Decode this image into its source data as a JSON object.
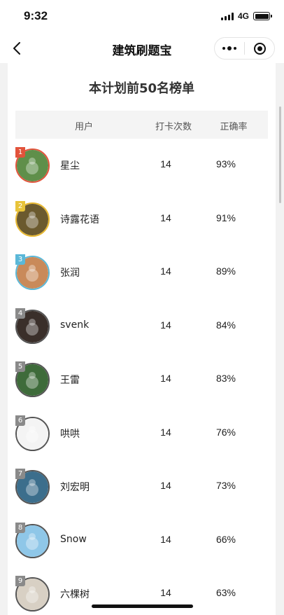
{
  "status": {
    "time": "9:32",
    "network": "4G"
  },
  "nav": {
    "title": "建筑刷题宝",
    "more_icon": "more-dots-icon",
    "close_icon": "target-icon"
  },
  "board": {
    "title": "本计划前50名榜单",
    "columns": {
      "user": "用户",
      "count": "打卡次数",
      "rate": "正确率"
    },
    "rows": [
      {
        "rank": "1",
        "name": "星尘",
        "count": "14",
        "rate": "93%",
        "badge": "#e2533b",
        "ring": "#e2533b",
        "bg": "#5f8f4a"
      },
      {
        "rank": "2",
        "name": "诗露花语",
        "count": "14",
        "rate": "91%",
        "badge": "#e8c43a",
        "ring": "#e8b830",
        "bg": "#6b5a2e"
      },
      {
        "rank": "3",
        "name": "张润",
        "count": "14",
        "rate": "89%",
        "badge": "#5bb8d8",
        "ring": "#5bb8d8",
        "bg": "#c98a5a"
      },
      {
        "rank": "4",
        "name": "svenk",
        "count": "14",
        "rate": "84%",
        "badge": "#8a8a8a",
        "ring": "#555",
        "bg": "#3a2f2a"
      },
      {
        "rank": "5",
        "name": "王雷",
        "count": "14",
        "rate": "83%",
        "badge": "#8a8a8a",
        "ring": "#555",
        "bg": "#3e6b3a"
      },
      {
        "rank": "6",
        "name": "哄哄",
        "count": "14",
        "rate": "76%",
        "badge": "#8a8a8a",
        "ring": "#555",
        "bg": "#f4f4f4"
      },
      {
        "rank": "7",
        "name": "刘宏明",
        "count": "14",
        "rate": "73%",
        "badge": "#8a8a8a",
        "ring": "#555",
        "bg": "#3c6e8c"
      },
      {
        "rank": "8",
        "name": "Snow",
        "count": "14",
        "rate": "66%",
        "badge": "#8a8a8a",
        "ring": "#555",
        "bg": "#8fc7e8"
      },
      {
        "rank": "9",
        "name": "六棵树",
        "count": "14",
        "rate": "63%",
        "badge": "#8a8a8a",
        "ring": "#555",
        "bg": "#d8d0c4"
      }
    ]
  }
}
